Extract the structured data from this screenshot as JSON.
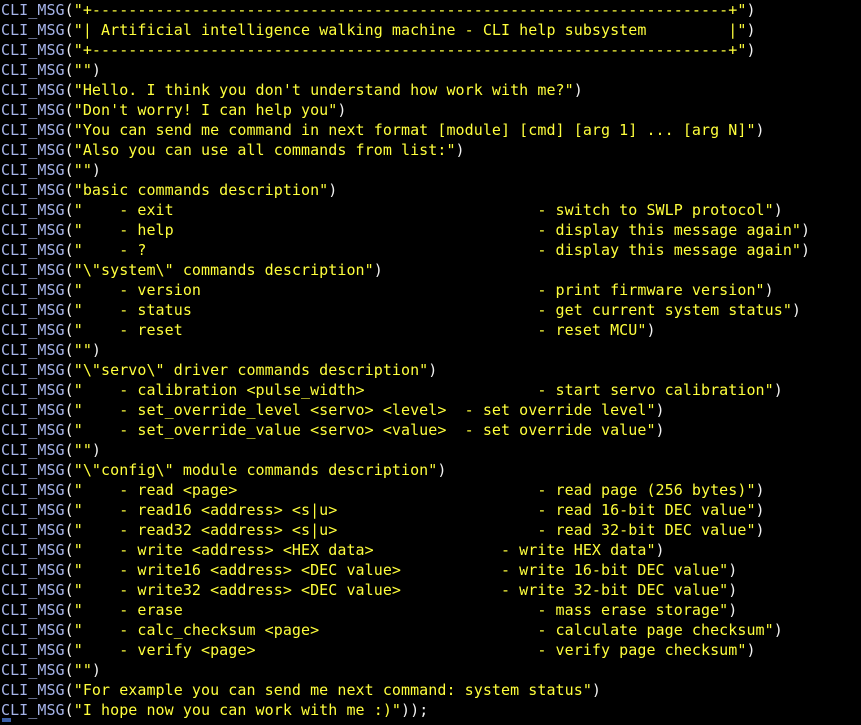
{
  "editor": {
    "title": "CLI help subsystem source",
    "language": "c",
    "background_color": "#000000",
    "function_color": "#a5b3e8",
    "punctuation_color": "#f2f2f2",
    "string_color": "#ffff3c",
    "cursor_color": "#3b5ea8",
    "function_name": "CLI_MSG",
    "open_paren": "(",
    "close_paren": ")",
    "quote": "\"",
    "statement_terminator": ");"
  },
  "lines": [
    {
      "id": 1,
      "string": "+----------------------------------------------------------------------+",
      "terminator": ")"
    },
    {
      "id": 2,
      "string": "| Artificial intelligence walking machine - CLI help subsystem         |",
      "terminator": ")"
    },
    {
      "id": 3,
      "string": "+----------------------------------------------------------------------+",
      "terminator": ")"
    },
    {
      "id": 4,
      "string": "",
      "terminator": ")"
    },
    {
      "id": 5,
      "string": "Hello. I think you don't understand how work with me?",
      "terminator": ")"
    },
    {
      "id": 6,
      "string": "Don't worry! I can help you",
      "terminator": ")"
    },
    {
      "id": 7,
      "string": "You can send me command in next format [module] [cmd] [arg 1] ... [arg N]",
      "terminator": ")"
    },
    {
      "id": 8,
      "string": "Also you can use all commands from list:",
      "terminator": ")"
    },
    {
      "id": 9,
      "string": "",
      "terminator": ")"
    },
    {
      "id": 10,
      "string": "basic commands description",
      "terminator": ")"
    },
    {
      "id": 11,
      "string": "    - exit                                        - switch to SWLP protocol",
      "terminator": ")"
    },
    {
      "id": 12,
      "string": "    - help                                        - display this message again",
      "terminator": ")"
    },
    {
      "id": 13,
      "string": "    - ?                                           - display this message again",
      "terminator": ")"
    },
    {
      "id": 14,
      "string": "\\\"system\\\" commands description",
      "terminator": ")"
    },
    {
      "id": 15,
      "string": "    - version                                     - print firmware version",
      "terminator": ")"
    },
    {
      "id": 16,
      "string": "    - status                                      - get current system status",
      "terminator": ")"
    },
    {
      "id": 17,
      "string": "    - reset                                       - reset MCU",
      "terminator": ")"
    },
    {
      "id": 18,
      "string": "",
      "terminator": ")"
    },
    {
      "id": 19,
      "string": "\\\"servo\\\" driver commands description",
      "terminator": ")"
    },
    {
      "id": 20,
      "string": "    - calibration <pulse_width>                   - start servo calibration",
      "terminator": ")"
    },
    {
      "id": 21,
      "string": "    - set_override_level <servo> <level>  - set override level",
      "terminator": ")"
    },
    {
      "id": 22,
      "string": "    - set_override_value <servo> <value>  - set override value",
      "terminator": ")"
    },
    {
      "id": 23,
      "string": "",
      "terminator": ")"
    },
    {
      "id": 24,
      "string": "\\\"config\\\" module commands description",
      "terminator": ")"
    },
    {
      "id": 25,
      "string": "    - read <page>                                 - read page (256 bytes)",
      "terminator": ")"
    },
    {
      "id": 26,
      "string": "    - read16 <address> <s|u>                      - read 16-bit DEC value",
      "terminator": ")"
    },
    {
      "id": 27,
      "string": "    - read32 <address> <s|u>                      - read 32-bit DEC value",
      "terminator": ")"
    },
    {
      "id": 28,
      "string": "    - write <address> <HEX data>              - write HEX data",
      "terminator": ")"
    },
    {
      "id": 29,
      "string": "    - write16 <address> <DEC value>           - write 16-bit DEC value",
      "terminator": ")"
    },
    {
      "id": 30,
      "string": "    - write32 <address> <DEC value>           - write 32-bit DEC value",
      "terminator": ")"
    },
    {
      "id": 31,
      "string": "    - erase                                       - mass erase storage",
      "terminator": ")"
    },
    {
      "id": 32,
      "string": "    - calc_checksum <page>                        - calculate page checksum",
      "terminator": ")"
    },
    {
      "id": 33,
      "string": "    - verify <page>                               - verify page checksum",
      "terminator": ")"
    },
    {
      "id": 34,
      "string": "",
      "terminator": ")"
    },
    {
      "id": 35,
      "string": "For example you can send me next command: system status",
      "terminator": ")"
    },
    {
      "id": 36,
      "string": "I hope now you can work with me :)",
      "terminator": "));"
    }
  ]
}
